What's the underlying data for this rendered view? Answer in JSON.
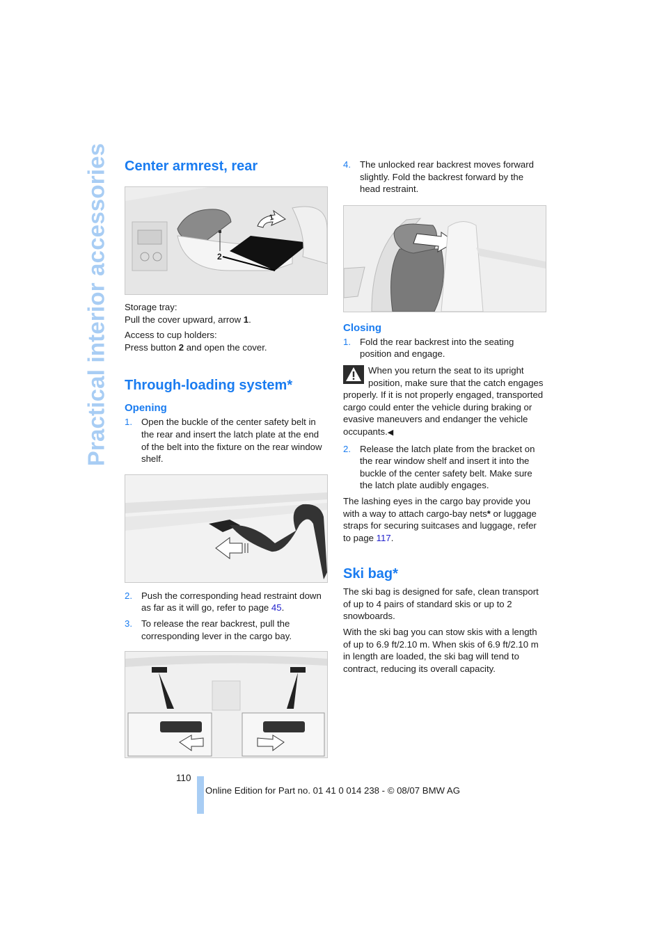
{
  "side_title": "Practical interior accessories",
  "left": {
    "armrest": {
      "heading": "Center armrest, rear",
      "figure_callouts": [
        "1",
        "2"
      ],
      "storage_label": "Storage tray:",
      "storage_text_pre": "Pull the cover upward, arrow ",
      "storage_bold": "1",
      "storage_text_post": ".",
      "cup_label": "Access to cup holders:",
      "cup_text_pre": "Press button ",
      "cup_bold": "2",
      "cup_text_post": " and open the cover."
    },
    "through_loading": {
      "heading": "Through-loading system*",
      "opening_heading": "Opening",
      "step1_num": "1.",
      "step1_text": "Open the buckle of the center safety belt in the rear and insert the latch plate at the end of the belt into the fixture on the rear window shelf.",
      "step2_num": "2.",
      "step2_text_pre": "Push the corresponding head restraint down as far as it will go, refer to page ",
      "step2_link": "45",
      "step2_text_post": ".",
      "step3_num": "3.",
      "step3_text": "To release the rear backrest, pull the corresponding lever in the cargo bay."
    }
  },
  "right": {
    "step4_num": "4.",
    "step4_text": "The unlocked rear backrest moves forward slightly. Fold the backrest forward by the head restraint.",
    "closing": {
      "heading": "Closing",
      "step1_num": "1.",
      "step1_text": "Fold the rear backrest into the seating position and engage.",
      "warning_text": "When you return the seat to its upright position, make sure that the catch engages properly. If it is not properly engaged, transported cargo could enter the vehicle during braking or evasive maneuvers and endanger the vehicle occupants.",
      "end_mark": "◀",
      "step2_num": "2.",
      "step2_text": "Release the latch plate from the bracket on the rear window shelf and insert it into the buckle of the center safety belt. Make sure the latch plate audibly engages.",
      "lashing_pre": "The lashing eyes in the cargo bay provide you with a way to attach cargo-bay nets",
      "lashing_star": "*",
      "lashing_mid": " or luggage straps for securing suitcases and luggage, refer to page ",
      "lashing_link": "117",
      "lashing_post": "."
    },
    "ski_bag": {
      "heading": "Ski bag*",
      "para1": "The ski bag is designed for safe, clean transport of up to 4 pairs of standard skis or up to 2 snowboards.",
      "para2": "With the ski bag you can stow skis with a length of up to 6.9 ft/2.10 m. When skis of 6.9 ft/2.10 m in length are loaded, the ski bag will tend to contract, reducing its overall capacity."
    }
  },
  "footer": {
    "page_number": "110",
    "edition": "Online Edition for Part no. 01 41 0 014 238 - © 08/07 BMW AG"
  },
  "colors": {
    "accent_blue": "#1a7cf0",
    "side_title_blue": "#a8cdf4",
    "link_blue": "#2222cc"
  }
}
